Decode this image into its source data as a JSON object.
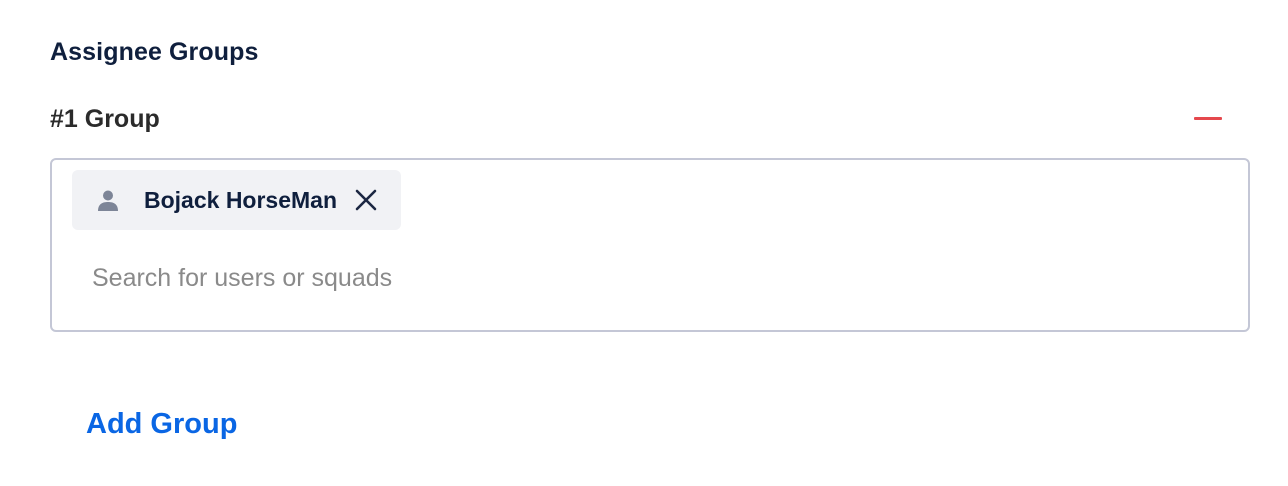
{
  "section": {
    "title": "Assignee Groups"
  },
  "groups": [
    {
      "title": "#1 Group",
      "remove_icon": "minus-icon",
      "members": [
        {
          "name": "Bojack HorseMan",
          "icon": "user-icon",
          "remove_icon": "close-icon"
        }
      ],
      "search": {
        "placeholder": "Search for users or squads",
        "value": ""
      }
    }
  ],
  "actions": {
    "add_group_label": "Add Group"
  },
  "colors": {
    "title": "#0f1f3d",
    "accent_link": "#0a66e4",
    "danger": "#e5484d",
    "chip_bg": "#f1f2f5",
    "border": "#c4c7d6"
  }
}
